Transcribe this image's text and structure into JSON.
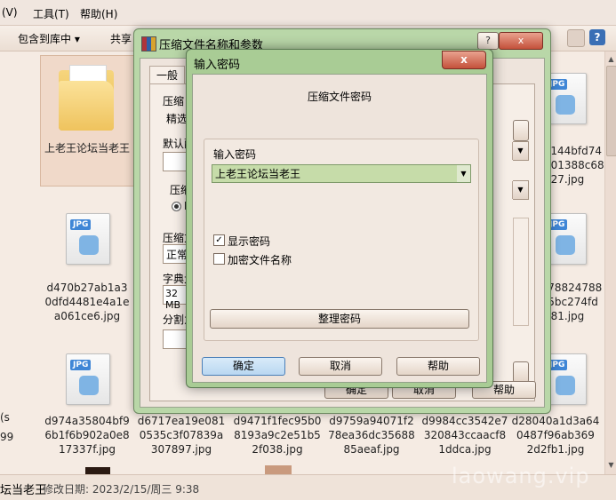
{
  "menubar": {
    "items": [
      "(V)",
      "工具(T)",
      "帮助(H)"
    ]
  },
  "toolbar": {
    "include_label": "包含到库中 ▾",
    "share_label": "共享"
  },
  "folder": {
    "name": "上老王论坛当老王"
  },
  "files": {
    "row1_right": [
      "a144bfd74",
      "001388c68",
      "027.jpg"
    ],
    "row2_left": [
      "d470b27ab1a3",
      "0dfd4481e4a1e",
      "a061ce6.jpg"
    ],
    "row2_right": [
      "f78824788",
      "f5bc274fd",
      "081.jpg"
    ],
    "row3": [
      [
        "d974a35804bf9",
        "6b1f6b902a0e8",
        "17337f.jpg"
      ],
      [
        "d6717ea19e081",
        "0535c3f07839a",
        "307897.jpg"
      ],
      [
        "d9471f1fec95b0",
        "8193a9c2e51b5",
        "2f038.jpg"
      ],
      [
        "d9759a94071f2",
        "78ea36dc35688",
        "85aeaf.jpg"
      ],
      [
        "d9984cc3542e7",
        "320843ccaacf8",
        "1ddca.jpg"
      ],
      [
        "d28040a1d3a64",
        "0487f96ab369",
        "2d2fb1.jpg"
      ]
    ],
    "left_edge": [
      "99",
      "(s"
    ]
  },
  "statusbar": {
    "name": "坛当老王",
    "modified": "修改日期: 2023/2/15/周三 9:38"
  },
  "back_dialog": {
    "title": "压缩文件名称和参数",
    "help_btn": "?",
    "tab_general": "一般",
    "labels": {
      "archive_name": "压缩",
      "select": "精选",
      "default": "默认配",
      "compress_format": "压缩",
      "r": "R",
      "compress_method": "压缩方",
      "method_value": "正常",
      "dict": "字典大",
      "dict_value": "32 MB",
      "split": "分割为"
    },
    "footer": {
      "ok": "确定",
      "cancel": "取消",
      "help": "帮助"
    }
  },
  "pwd_dialog": {
    "title": "输入密码",
    "close": "x",
    "heading": "压缩文件密码",
    "input_label": "输入密码",
    "input_value": "上老王论坛当老王",
    "show_password": {
      "label": "显示密码",
      "checked": true
    },
    "encrypt_names": {
      "label": "加密文件名称",
      "checked": false
    },
    "organize": "整理密码",
    "ok": "确定",
    "cancel": "取消",
    "help": "帮助"
  },
  "watermark": "laowang.vip"
}
